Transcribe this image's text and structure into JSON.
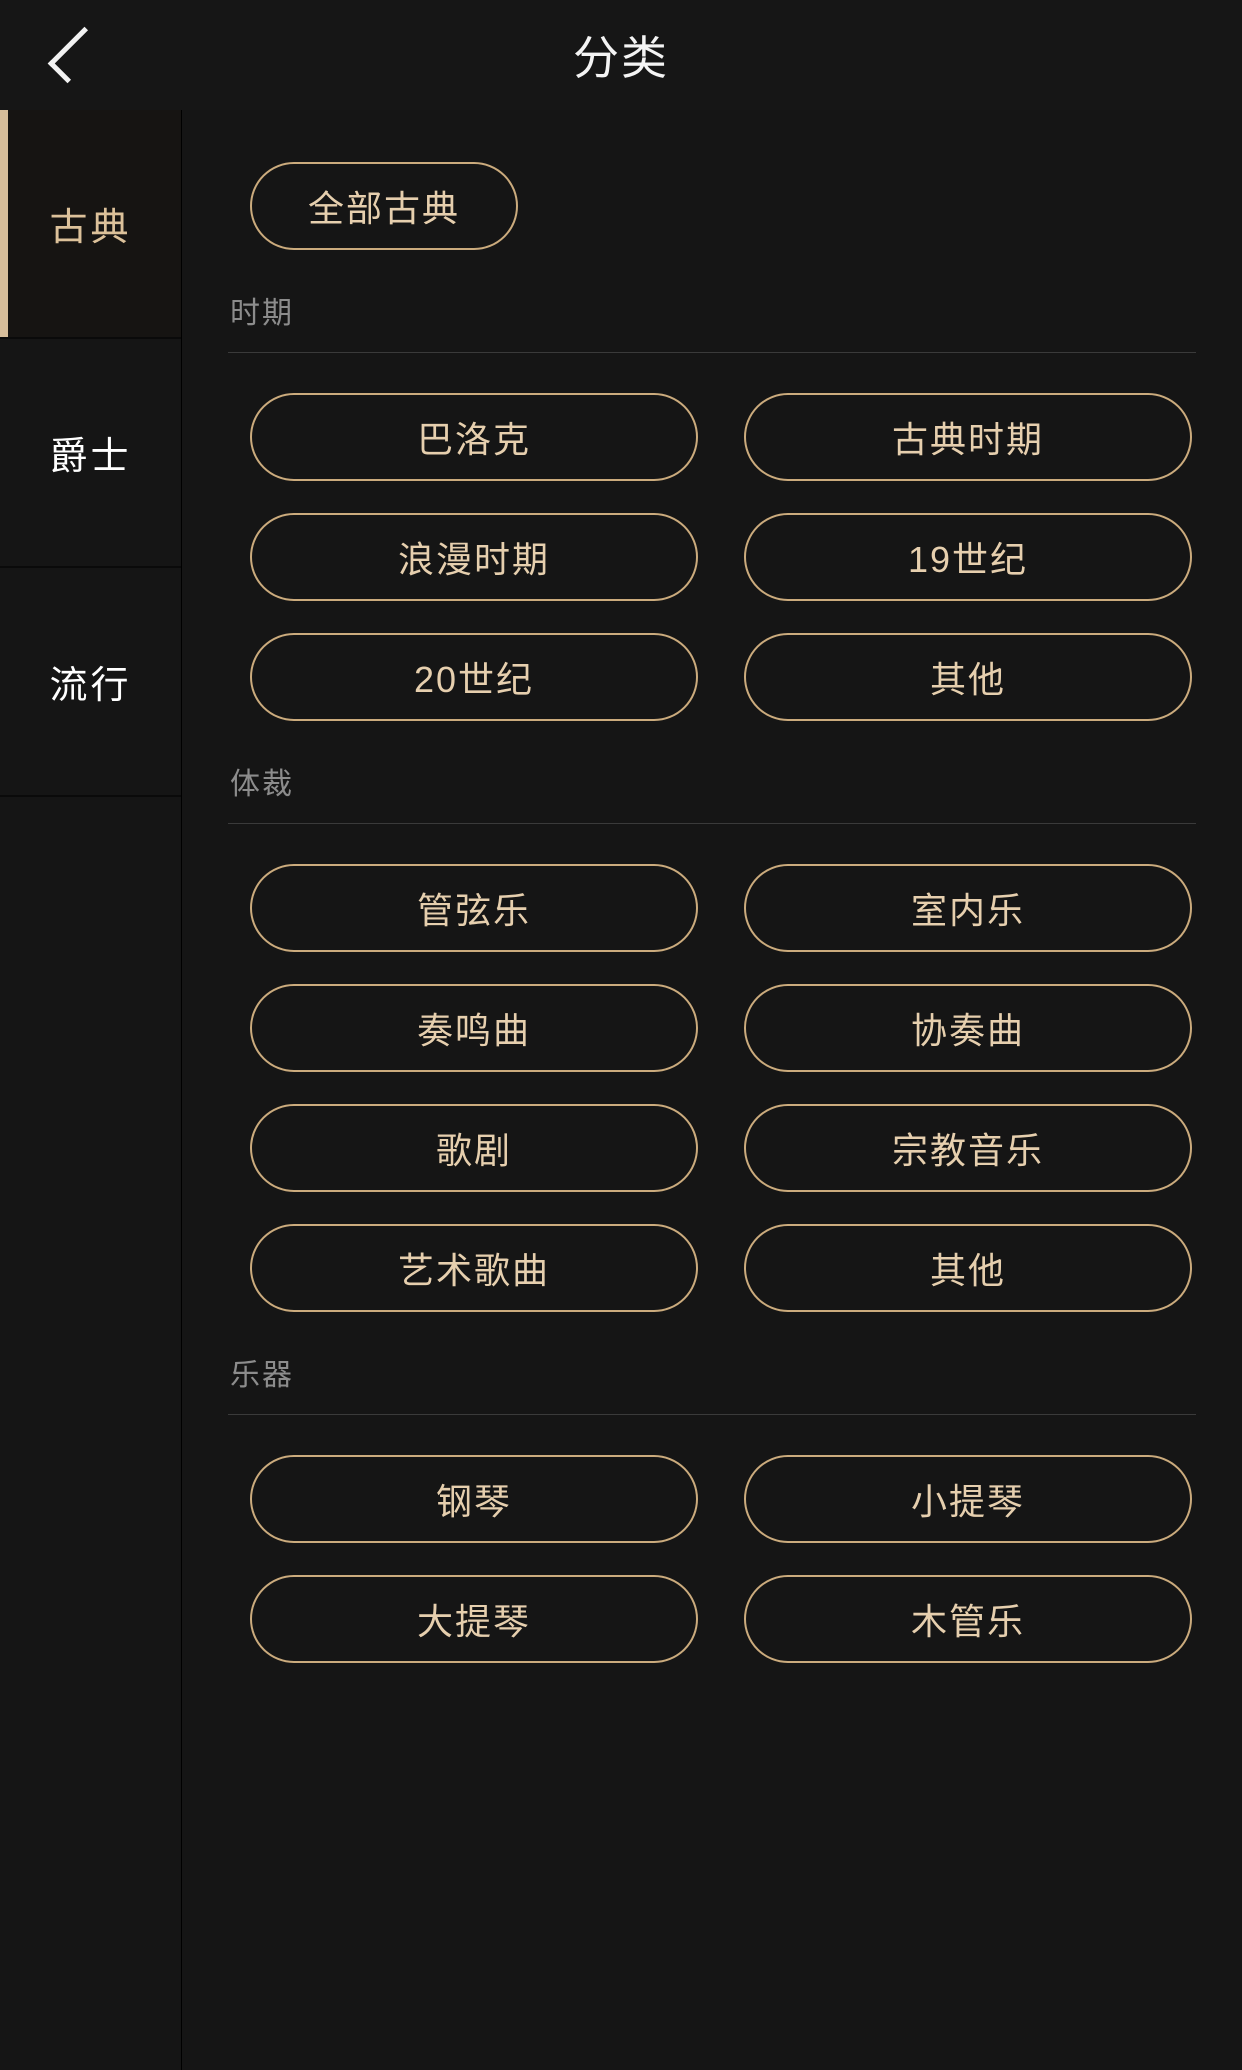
{
  "header": {
    "title": "分类",
    "back_icon": "chevron-left-icon"
  },
  "sidebar": {
    "items": [
      {
        "label": "古典",
        "active": true
      },
      {
        "label": "爵士",
        "active": false
      },
      {
        "label": "流行",
        "active": false
      }
    ]
  },
  "main": {
    "all_pill": "全部古典",
    "sections": [
      {
        "label": "时期",
        "options": [
          "巴洛克",
          "古典时期",
          "浪漫时期",
          "19世纪",
          "20世纪",
          "其他"
        ]
      },
      {
        "label": "体裁",
        "options": [
          "管弦乐",
          "室内乐",
          "奏鸣曲",
          "协奏曲",
          "歌剧",
          "宗教音乐",
          "艺术歌曲",
          "其他"
        ]
      },
      {
        "label": "乐器",
        "options": [
          "钢琴",
          "小提琴",
          "大提琴",
          "木管乐"
        ]
      }
    ]
  },
  "colors": {
    "background": "#151515",
    "accent_gold": "#cbab7d",
    "text_gold": "#e6cfae",
    "text_muted": "#8c8c8c",
    "text_primary": "#ffffff"
  }
}
